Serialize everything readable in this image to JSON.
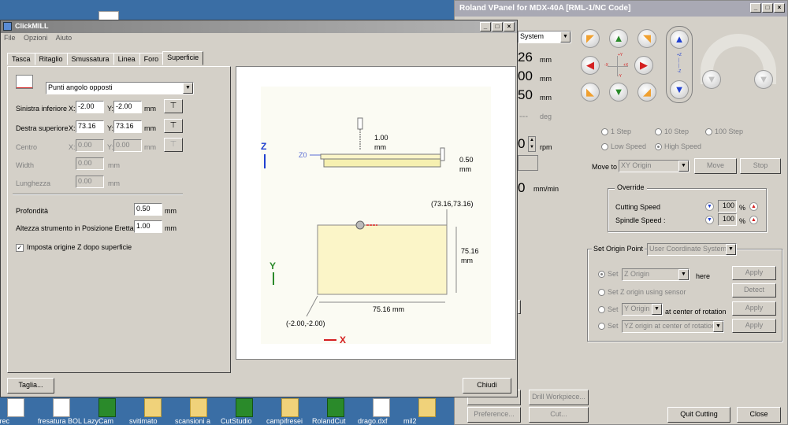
{
  "clickmill": {
    "title": "ClickMILL",
    "menu": [
      "File",
      "Opzioni",
      "Aiuto"
    ],
    "tabs": [
      "Tasca",
      "Ritaglio",
      "Smussatura",
      "Linea",
      "Foro",
      "Superficie"
    ],
    "active_tab": "Superficie",
    "mode_select": "Punti angolo opposti",
    "rows": {
      "lower_left_label": "Sinistra inferiore",
      "upper_right_label": "Destra superiore",
      "center_label": "Centro",
      "width_label": "Width",
      "length_label": "Lunghezza",
      "x_prefix": "X:",
      "y_prefix": "Y:",
      "unit": "mm",
      "lower_left_x": "-2.00",
      "lower_left_y": "-2.00",
      "upper_right_x": "73.16",
      "upper_right_y": "73.16",
      "center_x": "0.00",
      "center_y": "0.00",
      "width": "0.00",
      "length": "0.00"
    },
    "depth_label": "Profondità",
    "depth_value": "0.50",
    "height_label": "Altezza strumento in Posizione Eretta",
    "height_value": "1.00",
    "checkbox_label": "Imposta origine Z dopo superficie",
    "checkbox_checked": true,
    "cut_button": "Taglia...",
    "close_button": "Chiudi",
    "preview": {
      "z_axis": "Z",
      "z0": "Z0",
      "tool_up": "1.00",
      "tool_up_unit": "mm",
      "depth": "0.50",
      "depth_unit": "mm",
      "top_right": "(73.16,73.16)",
      "height_dim": "75.16",
      "height_unit": "mm",
      "width_dim": "75.16 mm",
      "bottom_left": "(-2.00,-2.00)",
      "y_axis": "Y",
      "x_axis": "X"
    }
  },
  "vpanel": {
    "title": "Roland VPanel for MDX-40A [RML-1/NC Code]",
    "coord_select": "System",
    "readouts": [
      "26",
      "00",
      "50",
      "---"
    ],
    "readout_units": [
      "mm",
      "mm",
      "mm",
      "deg"
    ],
    "spindle_value": "0",
    "spindle_unit": "rpm",
    "feed_value": "0",
    "feed_unit": "mm/min",
    "step_options": [
      "1 Step",
      "10 Step",
      "100 Step"
    ],
    "speed_options": [
      "Low Speed",
      "High Speed"
    ],
    "move_to_label": "Move to",
    "move_to_value": "XY Origin",
    "move_button": "Move",
    "stop_button": "Stop",
    "override": {
      "title": "Override",
      "cutting_label": "Cutting Speed",
      "cutting_value": "100",
      "spindle_label": "Spindle Speed :",
      "spindle_value": "100",
      "unit": "%"
    },
    "origin": {
      "title": "Set Origin Point",
      "coord_select": "User Coordinate System",
      "set_label": "Set",
      "z_origin": "Z Origin",
      "here": "here",
      "apply": "Apply",
      "z_sensor": "Set Z origin using sensor",
      "detect": "Detect",
      "y_origin": "Y Origin",
      "at_center": "at center of rotation",
      "yz_origin": "YZ origin at center of rotation"
    },
    "bottom_buttons": [
      "Drill Workpiece...",
      "Preference...",
      "Cut...",
      "Quit Cutting",
      "Close"
    ],
    "jog_labels": {
      "plus_y": "+Y",
      "minus_x": "-X",
      "plus_x": "+X",
      "minus_y": "-Y",
      "plus_z": "+Z",
      "minus_z": "-Z"
    }
  },
  "desktop": {
    "icons": [
      "i_frec",
      "fresatura BOL",
      "LazyCam",
      "svitimato",
      "scansioni a",
      "CutStudio",
      "campifresei",
      "RolandCut",
      "drago.dxf",
      "mil2"
    ]
  },
  "colors": {
    "jog_green": "#2a8a2a",
    "jog_red": "#d42020",
    "jog_orange": "#f0a030",
    "jog_blue": "#2040d0",
    "desktop": "#3a6ea5"
  }
}
